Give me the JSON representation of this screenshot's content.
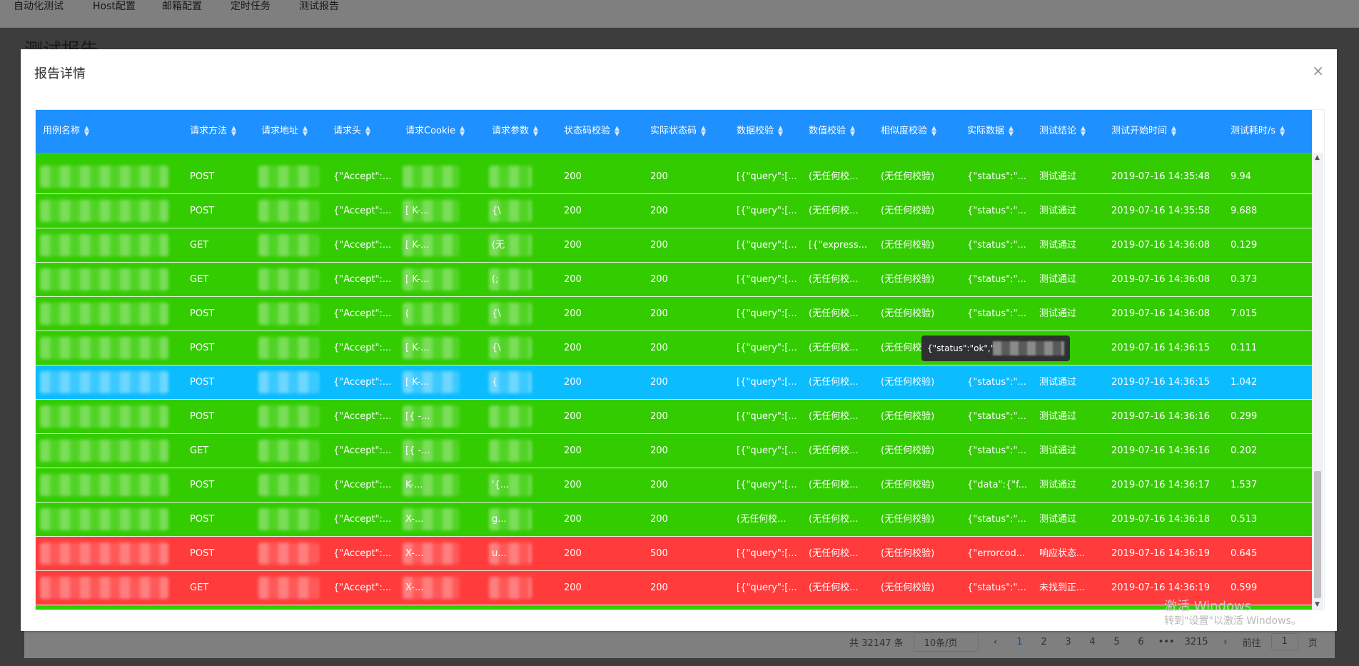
{
  "nav": {
    "items": [
      "自动化测试",
      "Host配置",
      "邮箱配置",
      "定时任务",
      "测试报告"
    ]
  },
  "page": {
    "title": "测试报告"
  },
  "pagination": {
    "total": "共 32147 条",
    "page_size": "10条/页",
    "prev": "‹",
    "pages": [
      "1",
      "2",
      "3",
      "4",
      "5",
      "6",
      "•••",
      "3215"
    ],
    "next": "›",
    "goto_label": "前往",
    "goto_value": "1",
    "goto_suffix": "页"
  },
  "dialog": {
    "title": "报告详情",
    "close": "×",
    "columns": [
      "用例名称",
      "请求方法",
      "请求地址",
      "请求头",
      "请求Cookie",
      "请求参数",
      "状态码校验",
      "实际状态码",
      "数据校验",
      "数值校验",
      "相似度校验",
      "实际数据",
      "测试结论",
      "测试开始时间",
      "测试耗时/s"
    ],
    "rows": [
      {
        "status": "pass",
        "method": "POST",
        "header": "{\"Accept\":...",
        "cookie": "",
        "params": "",
        "code_check": "200",
        "actual_code": "200",
        "data_check": "[{\"query\":[...",
        "value_check": "(无任何校...",
        "sim_check": "(无任何校验)",
        "actual_data": "{\"status\":\"...",
        "result": "测试通过",
        "start": "2019-07-16 14:35:48",
        "cost": "9.94"
      },
      {
        "status": "pass",
        "method": "POST",
        "header": "{\"Accept\":...",
        "cookie": "[ K-...",
        "params": "{\\",
        "code_check": "200",
        "actual_code": "200",
        "data_check": "[{\"query\":[...",
        "value_check": "(无任何校...",
        "sim_check": "(无任何校验)",
        "actual_data": "{\"status\":\"...",
        "result": "测试通过",
        "start": "2019-07-16 14:35:58",
        "cost": "9.688"
      },
      {
        "status": "pass",
        "method": "GET",
        "header": "{\"Accept\":...",
        "cookie": "[ K-...",
        "params": "(无",
        "code_check": "200",
        "actual_code": "200",
        "data_check": "[{\"query\":[...",
        "value_check": "[{\"express...",
        "sim_check": "(无任何校验)",
        "actual_data": "{\"status\":\"...",
        "result": "测试通过",
        "start": "2019-07-16 14:36:08",
        "cost": "0.129"
      },
      {
        "status": "pass",
        "method": "GET",
        "header": "{\"Accept\":...",
        "cookie": "[ K-...",
        "params": "(;",
        "code_check": "200",
        "actual_code": "200",
        "data_check": "[{\"query\":[...",
        "value_check": "(无任何校...",
        "sim_check": "(无任何校验)",
        "actual_data": "{\"status\":\"...",
        "result": "测试通过",
        "start": "2019-07-16 14:36:08",
        "cost": "0.373"
      },
      {
        "status": "pass",
        "method": "POST",
        "header": "{\"Accept\":...",
        "cookie": "(",
        "params": "{\\",
        "code_check": "200",
        "actual_code": "200",
        "data_check": "[{\"query\":[...",
        "value_check": "(无任何校...",
        "sim_check": "(无任何校验)",
        "actual_data": "{\"status\":\"...",
        "result": "测试通过",
        "start": "2019-07-16 14:36:08",
        "cost": "7.015"
      },
      {
        "status": "pass",
        "method": "POST",
        "header": "{\"Accept\":...",
        "cookie": "[ K-...",
        "params": "{\\",
        "code_check": "200",
        "actual_code": "200",
        "data_check": "[{\"query\":[...",
        "value_check": "(无任何校...",
        "sim_check": "(无任何校",
        "actual_data": "",
        "result": "过",
        "start": "2019-07-16 14:36:15",
        "cost": "0.111"
      },
      {
        "status": "sel",
        "method": "POST",
        "header": "{\"Accept\":...",
        "cookie": "[ K-...",
        "params": "{",
        "code_check": "200",
        "actual_code": "200",
        "data_check": "[{\"query\":[...",
        "value_check": "(无任何校...",
        "sim_check": "(无任何校验)",
        "actual_data": "{\"status\":\"...",
        "result": "测试通过",
        "start": "2019-07-16 14:36:15",
        "cost": "1.042"
      },
      {
        "status": "pass",
        "method": "POST",
        "header": "{\"Accept\":...",
        "cookie": "[{ -...",
        "params": "",
        "code_check": "200",
        "actual_code": "200",
        "data_check": "[{\"query\":[...",
        "value_check": "(无任何校...",
        "sim_check": "(无任何校验)",
        "actual_data": "{\"status\":\"...",
        "result": "测试通过",
        "start": "2019-07-16 14:36:16",
        "cost": "0.299"
      },
      {
        "status": "pass",
        "method": "GET",
        "header": "{\"Accept\":...",
        "cookie": "[{ -...",
        "params": "",
        "code_check": "200",
        "actual_code": "200",
        "data_check": "[{\"query\":[...",
        "value_check": "(无任何校...",
        "sim_check": "(无任何校验)",
        "actual_data": "{\"status\":\"...",
        "result": "测试通过",
        "start": "2019-07-16 14:36:16",
        "cost": "0.202"
      },
      {
        "status": "pass",
        "method": "POST",
        "header": "{\"Accept\":...",
        "cookie": "K-...",
        "params": "'{...",
        "code_check": "200",
        "actual_code": "200",
        "data_check": "[{\"query\":[...",
        "value_check": "(无任何校...",
        "sim_check": "(无任何校验)",
        "actual_data": "{\"data\":{\"f...",
        "result": "测试通过",
        "start": "2019-07-16 14:36:17",
        "cost": "1.537"
      },
      {
        "status": "pass",
        "method": "POST",
        "header": "{\"Accept\":...",
        "cookie": "X-...",
        "params": "g...",
        "code_check": "200",
        "actual_code": "200",
        "data_check": "(无任何校...",
        "value_check": "(无任何校...",
        "sim_check": "(无任何校验)",
        "actual_data": "{\"status\":\"...",
        "result": "测试通过",
        "start": "2019-07-16 14:36:18",
        "cost": "0.513"
      },
      {
        "status": "fail",
        "method": "POST",
        "header": "{\"Accept\":...",
        "cookie": "X-...",
        "params": "u...",
        "code_check": "200",
        "actual_code": "500",
        "data_check": "[{\"query\":[...",
        "value_check": "(无任何校...",
        "sim_check": "(无任何校验)",
        "actual_data": "{\"errorcod...",
        "result": "响应状态...",
        "start": "2019-07-16 14:36:19",
        "cost": "0.645"
      },
      {
        "status": "fail",
        "method": "GET",
        "header": "{\"Accept\":...",
        "cookie": "X-...",
        "params": "",
        "code_check": "200",
        "actual_code": "200",
        "data_check": "[{\"query\":[...",
        "value_check": "(无任何校...",
        "sim_check": "(无任何校验)",
        "actual_data": "{\"status\":\"...",
        "result": "未找到正...",
        "start": "2019-07-16 14:36:19",
        "cost": "0.599"
      }
    ],
    "tooltip": "{\"status\":\"ok\",\"da"
  },
  "watermark": {
    "line1": "激活 Windows",
    "line2": "转到\"设置\"以激活 Windows。"
  },
  "colors": {
    "header": "#1e90ff",
    "pass": "#33cc00",
    "selected": "#0bbcff",
    "fail": "#ff3b3b"
  }
}
